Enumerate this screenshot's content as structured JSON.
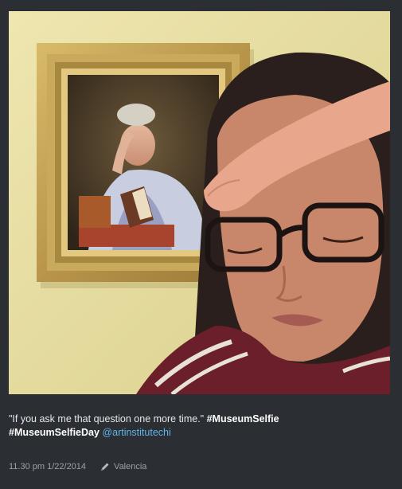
{
  "post": {
    "image_alt": "Museum selfie in front of a framed portrait",
    "caption_quote": "\"If you ask me that question one more time.\"",
    "hashtag_1": "#MuseumSelfie",
    "hashtag_2": "#MuseumSelfieDay",
    "mention": "@artinstitutechi",
    "timestamp": "11.30 pm 1/22/2014",
    "location": "Valencia",
    "location_icon": "pencil-icon"
  },
  "colors": {
    "background": "#2b2f33",
    "caption_text": "#e6e8ea",
    "mention": "#5fb4e8",
    "meta_text": "#9aa1a7"
  }
}
